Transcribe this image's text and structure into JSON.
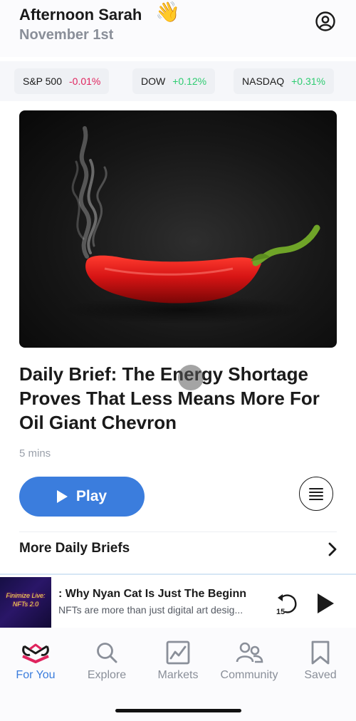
{
  "header": {
    "greeting": "Afternoon Sarah",
    "greeting_emoji": "👋",
    "date": "November 1st",
    "profile_icon": "user-circle-icon"
  },
  "tickers": [
    {
      "name": "S&P 500",
      "change": "-0.01%",
      "direction": "down"
    },
    {
      "name": "DOW",
      "change": "+0.12%",
      "direction": "up"
    },
    {
      "name": "NASDAQ",
      "change": "+0.31%",
      "direction": "up"
    }
  ],
  "brief": {
    "image": "red chili pepper with smoke on dark background",
    "title": "Daily Brief: The Energy Shortage Proves That Less Means More For Oil Giant Chevron",
    "duration": "5 mins",
    "play_label": "Play",
    "transcript_icon": "transcript-lines-icon"
  },
  "more": {
    "label": "More Daily Briefs"
  },
  "player": {
    "thumbnail_text_line1": "Finimize Live:",
    "thumbnail_text_line2": "NFTs 2.0",
    "title": ": Why Nyan Cat Is Just The Beginn",
    "subtitle": "NFTs are more than just digital art desig...",
    "rewind_seconds": "15"
  },
  "tabs": [
    {
      "id": "for-you",
      "label": "For You",
      "icon": "for-you-icon",
      "active": true
    },
    {
      "id": "explore",
      "label": "Explore",
      "icon": "search-icon",
      "active": false
    },
    {
      "id": "markets",
      "label": "Markets",
      "icon": "chart-icon",
      "active": false
    },
    {
      "id": "community",
      "label": "Community",
      "icon": "people-icon",
      "active": false
    },
    {
      "id": "saved",
      "label": "Saved",
      "icon": "bookmark-icon",
      "active": false
    }
  ],
  "colors": {
    "accent": "#3b7ddd",
    "negative": "#e0245e",
    "positive": "#2ecc71"
  }
}
